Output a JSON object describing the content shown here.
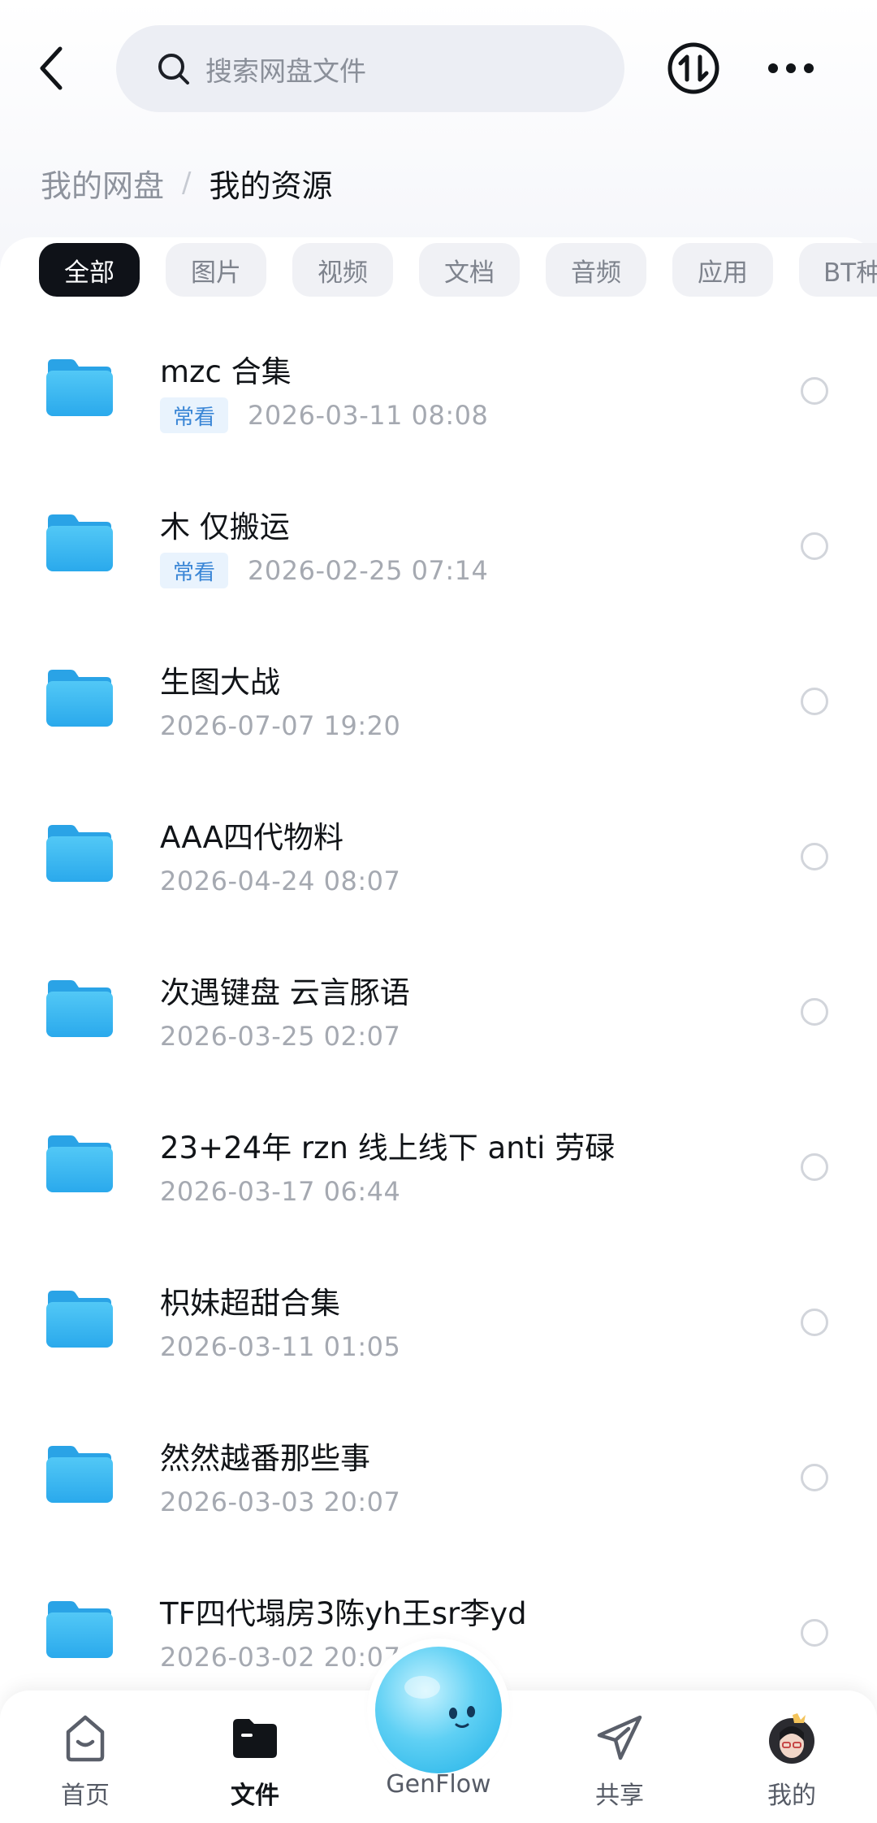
{
  "header": {
    "search_placeholder": "搜索网盘文件"
  },
  "breadcrumb": {
    "root": "我的网盘",
    "separator": "/",
    "current": "我的资源"
  },
  "filters": [
    {
      "label": "全部",
      "active": true
    },
    {
      "label": "图片",
      "active": false
    },
    {
      "label": "视频",
      "active": false
    },
    {
      "label": "文档",
      "active": false
    },
    {
      "label": "音频",
      "active": false
    },
    {
      "label": "应用",
      "active": false
    },
    {
      "label": "BT种",
      "active": false
    }
  ],
  "files": [
    {
      "name": "mzc 合集",
      "tag": "常看",
      "date": "2026-03-11  08:08"
    },
    {
      "name": "木 仅搬运",
      "tag": "常看",
      "date": "2026-02-25  07:14"
    },
    {
      "name": "生图大战",
      "tag": "",
      "date": "2026-07-07  19:20"
    },
    {
      "name": "AAA四代物料",
      "tag": "",
      "date": "2026-04-24  08:07"
    },
    {
      "name": "次遇键盘 云言豚语",
      "tag": "",
      "date": "2026-03-25  02:07"
    },
    {
      "name": "23+24年 rzn 线上线下 anti 劳碌",
      "tag": "",
      "date": "2026-03-17  06:44"
    },
    {
      "name": "枳妹超甜合集",
      "tag": "",
      "date": "2026-03-11  01:05"
    },
    {
      "name": "然然越番那些事",
      "tag": "",
      "date": "2026-03-03  20:07"
    },
    {
      "name": "TF四代塌房3陈yh王sr李yd",
      "tag": "",
      "date": "2026-03-02  20:07"
    }
  ],
  "nav": {
    "home": "首页",
    "files": "文件",
    "genflow": "GenFlow",
    "share": "共享",
    "mine": "我的"
  },
  "colors": {
    "folder": "#3cb8f0",
    "active_chip": "#0f1218",
    "tag_bg": "#e9f3fd",
    "tag_text": "#3a86d6"
  }
}
